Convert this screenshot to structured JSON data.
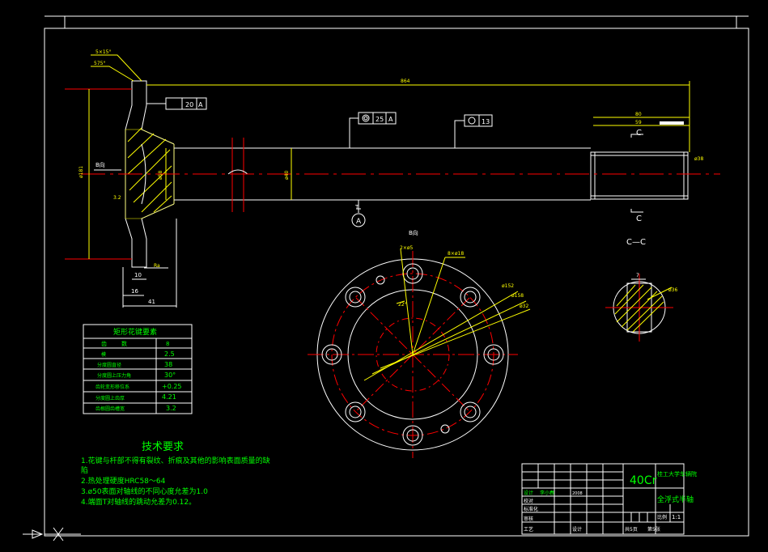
{
  "colors": {
    "background": "#000000",
    "outline": "#ffffff",
    "dimension": "#ffff00",
    "centerline": "#ff0000",
    "text": "#00ff00",
    "hatch": "#ffff00"
  },
  "dims": {
    "length_total": "864",
    "flange_d": "ø181",
    "hub_d": "ø58",
    "shaft_d": "ø40",
    "spline_len1": "80",
    "spline_len2": "59",
    "spline_d": "ø38",
    "flange_t": "16",
    "hub_l": "41",
    "rim": "10",
    "chamfer": "5×15°",
    "angle": "575°",
    "ra": "3.2",
    "ra2": "Ra",
    "bolt_circle": "ø152",
    "bolt_outer": "ø158",
    "bolt_inner": "ø32",
    "holes2": "2×ø5",
    "holes8": "8×ø18",
    "ang": "22°",
    "cc_d": "ø36",
    "cc_w": "7"
  },
  "tolerances": {
    "t1_val": "20",
    "t1_ref": "A",
    "t2_val": "25",
    "t2_ref": "A",
    "t3_val": "13"
  },
  "labels": {
    "view_b1": "B向",
    "view_b2": "B向",
    "section_c": "C",
    "section_c_title": "C—C",
    "datum_a": "A",
    "datum_t": "T"
  },
  "spline_table": {
    "title": "矩形花键要素",
    "headers": [
      "齿",
      "数",
      "8"
    ],
    "rows": [
      [
        "模",
        "2.5"
      ],
      [
        "分度圆直径",
        "38"
      ],
      [
        "分度圆上压力角",
        "30°"
      ],
      [
        "齿轮变形移位系",
        "+0.25"
      ],
      [
        "分度圆上齿厚",
        "4.21"
      ],
      [
        "齿根圆齿槽宽",
        "3.2"
      ]
    ],
    "extra": "4.21"
  },
  "notes": {
    "title": "技术要求",
    "lines": [
      "1.花键与杆部不得有裂纹、折痕及其他的影响表面质量的缺",
      "陷",
      "2.热处理硬度HRC58～64",
      "3.ø50表面对轴线的不同心度允差为1.0",
      "4.端面T对轴线的跳动允差为0.12。"
    ]
  },
  "title_block": {
    "material": "40Cr",
    "school": "桂工大学车辆院",
    "part": "全浮式半轴",
    "scale": "1:1",
    "scale_label": "比例",
    "sheet": "共5页",
    "sheet2": "第5张",
    "designer": "设计",
    "approver": "审核",
    "std": "标准化",
    "date": "2008",
    "process": "工艺",
    "check": "校对",
    "design_label": "设计",
    "design_name": "李小春"
  }
}
